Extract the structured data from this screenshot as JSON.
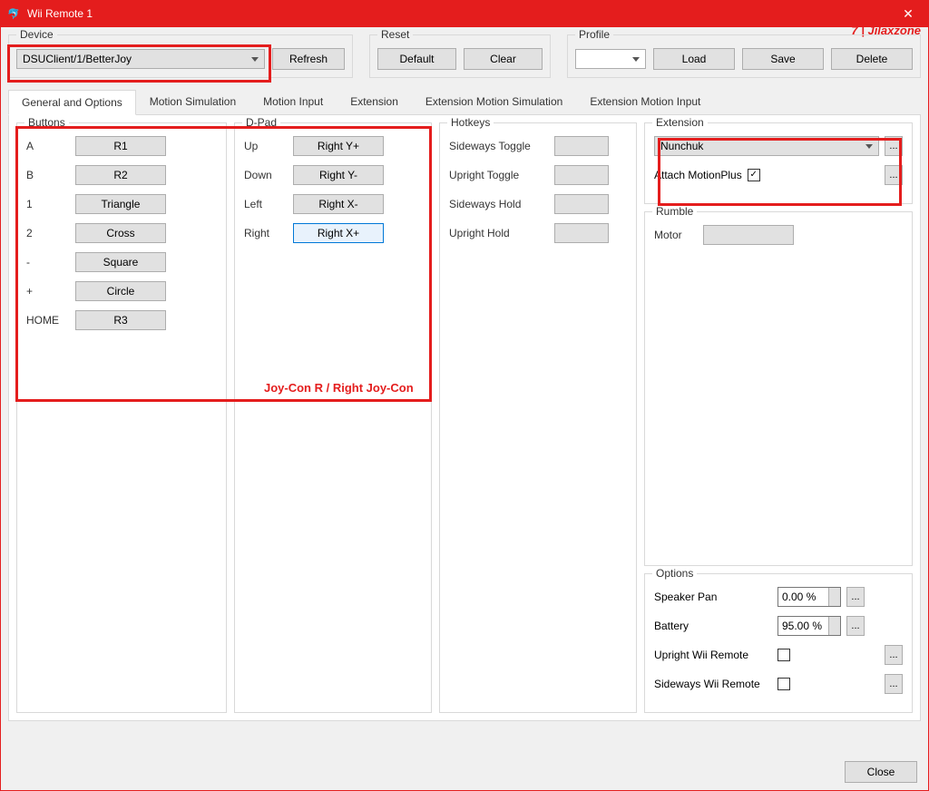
{
  "titlebar": {
    "title": "Wii Remote 1"
  },
  "annotation": {
    "topright": "7 | Jilaxzone",
    "joycon": "Joy-Con R / Right Joy-Con"
  },
  "device": {
    "label": "Device",
    "selected": "DSUClient/1/BetterJoy",
    "refresh": "Refresh"
  },
  "reset": {
    "label": "Reset",
    "default": "Default",
    "clear": "Clear"
  },
  "profile": {
    "label": "Profile",
    "selected": "",
    "load": "Load",
    "save": "Save",
    "delete": "Delete"
  },
  "tabs": {
    "general": "General and Options",
    "motion_sim": "Motion Simulation",
    "motion_input": "Motion Input",
    "extension": "Extension",
    "ext_motion_sim": "Extension Motion Simulation",
    "ext_motion_input": "Extension Motion Input"
  },
  "buttons": {
    "title": "Buttons",
    "rows": [
      {
        "lbl": "A",
        "val": "R1"
      },
      {
        "lbl": "B",
        "val": "R2"
      },
      {
        "lbl": "1",
        "val": "Triangle"
      },
      {
        "lbl": "2",
        "val": "Cross"
      },
      {
        "lbl": "-",
        "val": "Square"
      },
      {
        "lbl": "+",
        "val": "Circle"
      },
      {
        "lbl": "HOME",
        "val": "R3"
      }
    ]
  },
  "dpad": {
    "title": "D-Pad",
    "rows": [
      {
        "lbl": "Up",
        "val": "Right Y+"
      },
      {
        "lbl": "Down",
        "val": "Right Y-"
      },
      {
        "lbl": "Left",
        "val": "Right X-"
      },
      {
        "lbl": "Right",
        "val": "Right X+"
      }
    ]
  },
  "hotkeys": {
    "title": "Hotkeys",
    "rows": [
      {
        "lbl": "Sideways Toggle",
        "val": ""
      },
      {
        "lbl": "Upright Toggle",
        "val": ""
      },
      {
        "lbl": "Sideways Hold",
        "val": ""
      },
      {
        "lbl": "Upright Hold",
        "val": ""
      }
    ]
  },
  "extension_grp": {
    "title": "Extension",
    "selected": "Nunchuk",
    "attach_label": "Attach MotionPlus",
    "attach_checked": true
  },
  "rumble": {
    "title": "Rumble",
    "motor_label": "Motor",
    "motor_val": ""
  },
  "options": {
    "title": "Options",
    "speaker_pan_label": "Speaker Pan",
    "speaker_pan_val": "0.00 %",
    "battery_label": "Battery",
    "battery_val": "95.00 %",
    "upright_label": "Upright Wii Remote",
    "upright_checked": false,
    "sideways_label": "Sideways Wii Remote",
    "sideways_checked": false
  },
  "close": "Close"
}
